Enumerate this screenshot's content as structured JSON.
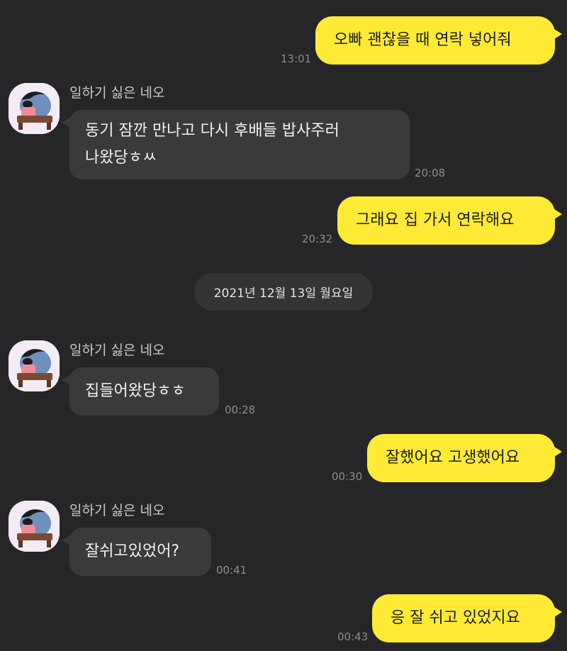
{
  "chat": {
    "sender_name": "일하기 싫은 네오",
    "date_divider": "2021년 12월 13일 월요일",
    "messages": [
      {
        "from": "me",
        "text": "오빠 괜찮을 때 연락 넣어줘",
        "time": "13:01"
      },
      {
        "from": "them",
        "text": "동기 잠깐 만나고 다시 후배들 밥사주러\n나왔당ㅎㅆ",
        "time": "20:08"
      },
      {
        "from": "me",
        "text": "그래요 집 가서 연락해요",
        "time": "20:32"
      },
      {
        "from": "them",
        "text": "집들어왔당ㅎㅎ",
        "time": "00:28"
      },
      {
        "from": "me",
        "text": "잘했어요 고생했어요",
        "time": "00:30"
      },
      {
        "from": "them",
        "text": "잘쉬고있었어?",
        "time": "00:41"
      },
      {
        "from": "me",
        "text": "응 잘 쉬고 있었지요",
        "time": "00:43"
      }
    ]
  },
  "colors": {
    "background": "#262628",
    "outgoing_bubble": "#ffeb35",
    "incoming_bubble": "#3a3a3c",
    "timestamp": "#8d8d8f"
  },
  "icons": {
    "avatar": "neo-character-avatar"
  }
}
